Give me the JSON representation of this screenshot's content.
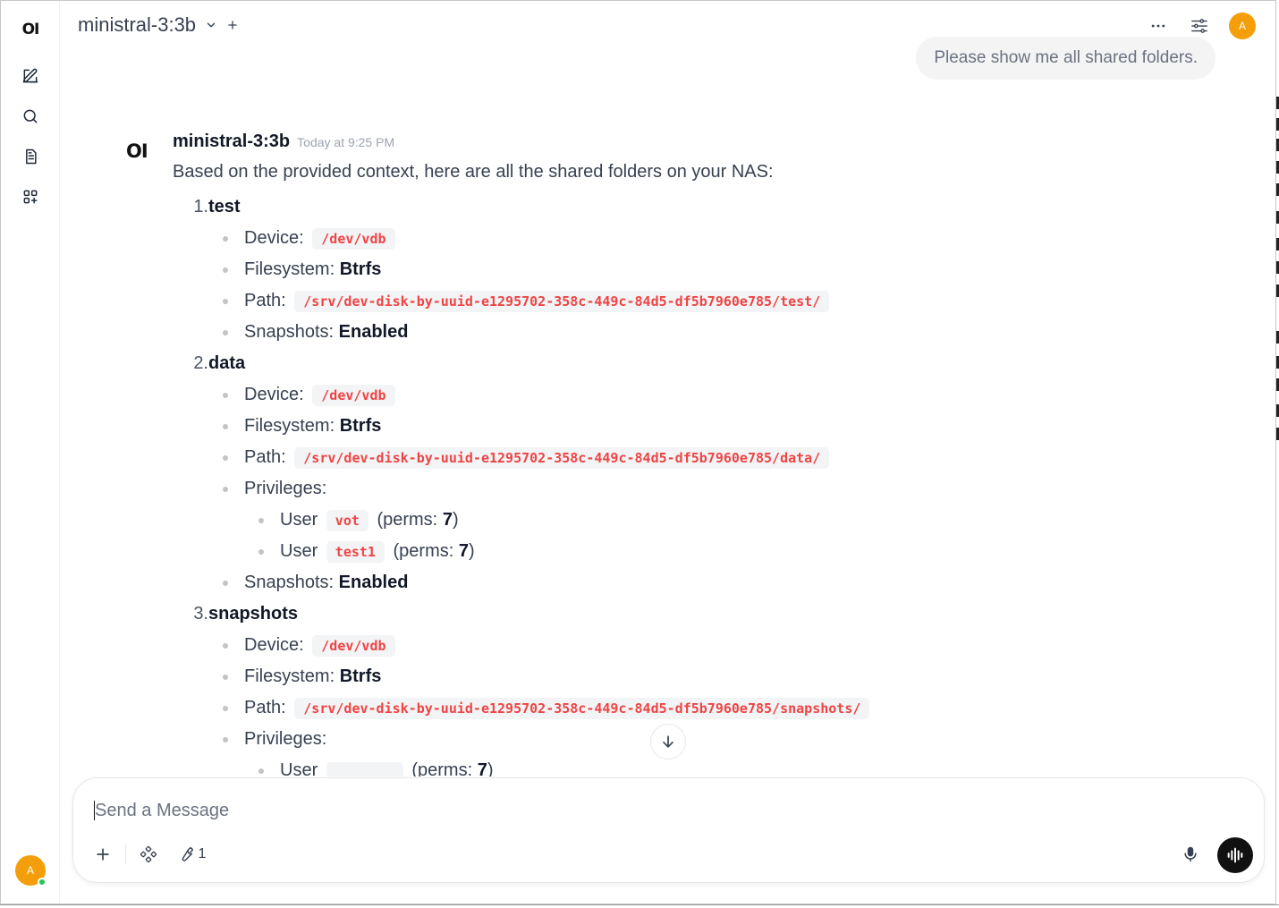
{
  "sidebar": {
    "logo": "OI",
    "user_initial": "A"
  },
  "header": {
    "model_name": "ministral-3:3b",
    "user_initial": "A"
  },
  "user_message": "Please show me all shared folders.",
  "assistant": {
    "logo": "OI",
    "name": "ministral-3:3b",
    "timestamp": "Today at 9:25 PM",
    "intro": "Based on the provided context, here are all the shared folders on your NAS:",
    "labels": {
      "device": "Device:",
      "filesystem": "Filesystem:",
      "path": "Path:",
      "privileges": "Privileges:",
      "snapshots": "Snapshots:",
      "user": "User",
      "perms_open": "(perms:",
      "perms_close": ")"
    },
    "folders": [
      {
        "number": "1.",
        "name": "test",
        "device": "/dev/vdb",
        "filesystem": "Btrfs",
        "path": "/srv/dev-disk-by-uuid-e1295702-358c-449c-84d5-df5b7960e785/test/",
        "snapshots": "Enabled"
      },
      {
        "number": "2.",
        "name": "data",
        "device": "/dev/vdb",
        "filesystem": "Btrfs",
        "path": "/srv/dev-disk-by-uuid-e1295702-358c-449c-84d5-df5b7960e785/data/",
        "privileges": [
          {
            "user": "vot",
            "perms": "7"
          },
          {
            "user": "test1",
            "perms": "7"
          }
        ],
        "snapshots": "Enabled"
      },
      {
        "number": "3.",
        "name": "snapshots",
        "device": "/dev/vdb",
        "filesystem": "Btrfs",
        "path": "/srv/dev-disk-by-uuid-e1295702-358c-449c-84d5-df5b7960e785/snapshots/",
        "privileges": [
          {
            "user": "",
            "perms": "7"
          }
        ]
      }
    ]
  },
  "composer": {
    "placeholder": "Send a Message",
    "tool_count": "1"
  }
}
